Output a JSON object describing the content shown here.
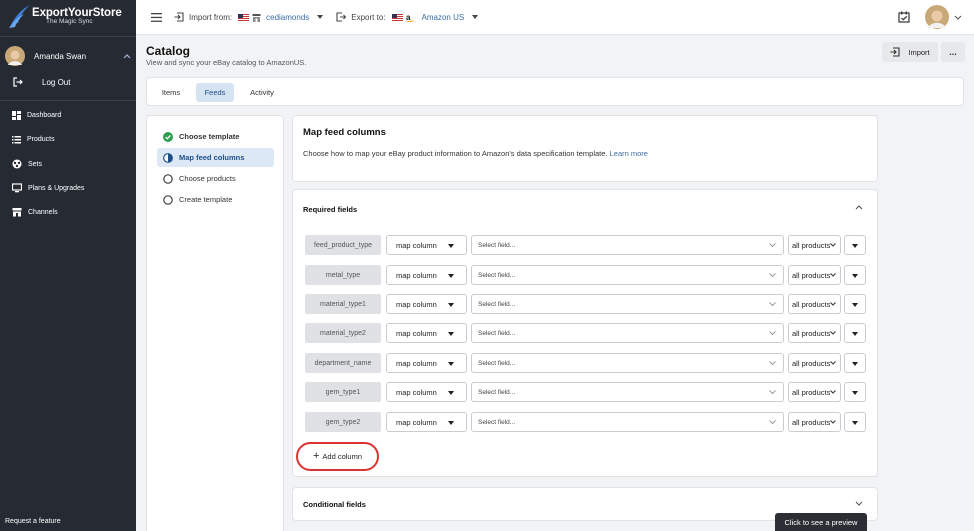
{
  "sidebar": {
    "logo": {
      "name": "ExportYourStore",
      "tagline": "The Magic Sync"
    },
    "user": {
      "name": "Amanda Swan"
    },
    "logout_label": "Log Out",
    "items": [
      {
        "label": "Dashboard",
        "icon": "dashboard-icon"
      },
      {
        "label": "Products",
        "icon": "list-icon"
      },
      {
        "label": "Sets",
        "icon": "sets-icon"
      },
      {
        "label": "Plans & Upgrades",
        "icon": "monitor-icon"
      },
      {
        "label": "Channels",
        "icon": "store-icon"
      }
    ],
    "request_feature": "Request a feature"
  },
  "topbar": {
    "import_label": "Import from:",
    "import_source": "cediamonds",
    "export_label": "Export to:",
    "export_target": "Amazon US"
  },
  "header": {
    "title": "Catalog",
    "subtitle": "View and sync your eBay catalog to AmazonUS.",
    "import_button": "Import",
    "more_button": "..."
  },
  "tabs": [
    {
      "label": "Items",
      "active": false
    },
    {
      "label": "Feeds",
      "active": true
    },
    {
      "label": "Activity",
      "active": false
    }
  ],
  "steps": [
    {
      "label": "Choose template",
      "state": "done"
    },
    {
      "label": "Map feed columns",
      "state": "current"
    },
    {
      "label": "Choose products",
      "state": "todo"
    },
    {
      "label": "Create template",
      "state": "todo"
    }
  ],
  "map_card": {
    "title": "Map feed columns",
    "description": "Choose how to map your eBay product information to Amazon's data specification template.",
    "learn_more": "Learn more"
  },
  "required": {
    "title": "Required fields",
    "rows": [
      {
        "field": "feed_product_type",
        "mode": "map column",
        "placeholder": "Select field...",
        "scope": "all products"
      },
      {
        "field": "metal_type",
        "mode": "map column",
        "placeholder": "Select field...",
        "scope": "all products"
      },
      {
        "field": "material_type1",
        "mode": "map column",
        "placeholder": "Select field...",
        "scope": "all products"
      },
      {
        "field": "material_type2",
        "mode": "map column",
        "placeholder": "Select field...",
        "scope": "all products"
      },
      {
        "field": "department_name",
        "mode": "map column",
        "placeholder": "Select field...",
        "scope": "all products"
      },
      {
        "field": "gem_type1",
        "mode": "map column",
        "placeholder": "Select field...",
        "scope": "all products"
      },
      {
        "field": "gem_type2",
        "mode": "map column",
        "placeholder": "Select field...",
        "scope": "all products"
      }
    ],
    "add_column": "Add column"
  },
  "conditional": {
    "title": "Conditional fields"
  },
  "preview_label": "Click to see a preview",
  "colors": {
    "sidebar_bg": "#262b33",
    "accent": "#1f4f8a",
    "success": "#2e9e4f",
    "highlight": "#d33333"
  }
}
